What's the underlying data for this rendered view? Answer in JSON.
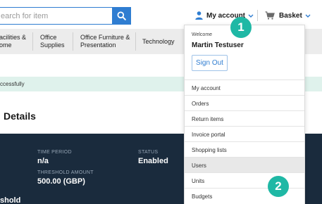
{
  "header": {
    "search": {
      "placeholder": "earch for item"
    },
    "account": {
      "label": "My account"
    },
    "basket": {
      "label": "Basket"
    }
  },
  "category_nav": [
    {
      "line1": "acilities &",
      "line2": "ome"
    },
    {
      "line1": "Office",
      "line2": "Supplies"
    },
    {
      "line1": "Office Furniture &",
      "line2": "Presentation"
    },
    {
      "line1": "Technology",
      "line2": ""
    }
  ],
  "message": {
    "text": "ccessfully"
  },
  "page": {
    "title": "Details"
  },
  "details": {
    "time_period_label": "TIME PERIOD",
    "time_period_value": "n/a",
    "status_label": "STATUS",
    "status_value": "Enabled",
    "threshold_label": "THRESHOLD AMOUNT",
    "threshold_value": "500.00 (GBP)",
    "partial_label": "shold"
  },
  "account_menu": {
    "welcome": "Welcome",
    "user_name": "Martin Testuser",
    "sign_out": "Sign Out",
    "items": [
      {
        "label": "My account"
      },
      {
        "label": "Orders"
      },
      {
        "label": "Return items"
      },
      {
        "label": "Invoice portal"
      },
      {
        "label": "Shopping lists"
      },
      {
        "label": "Users"
      },
      {
        "label": "Units"
      },
      {
        "label": "Budgets"
      }
    ]
  },
  "callouts": {
    "badge1": "1",
    "badge2": "2"
  },
  "colors": {
    "accent": "#2f7dd1",
    "panel": "#1a2b3d",
    "success_bg": "#dff2ec",
    "badge": "#1fb8a5",
    "active_item": "#e8e8e8"
  }
}
